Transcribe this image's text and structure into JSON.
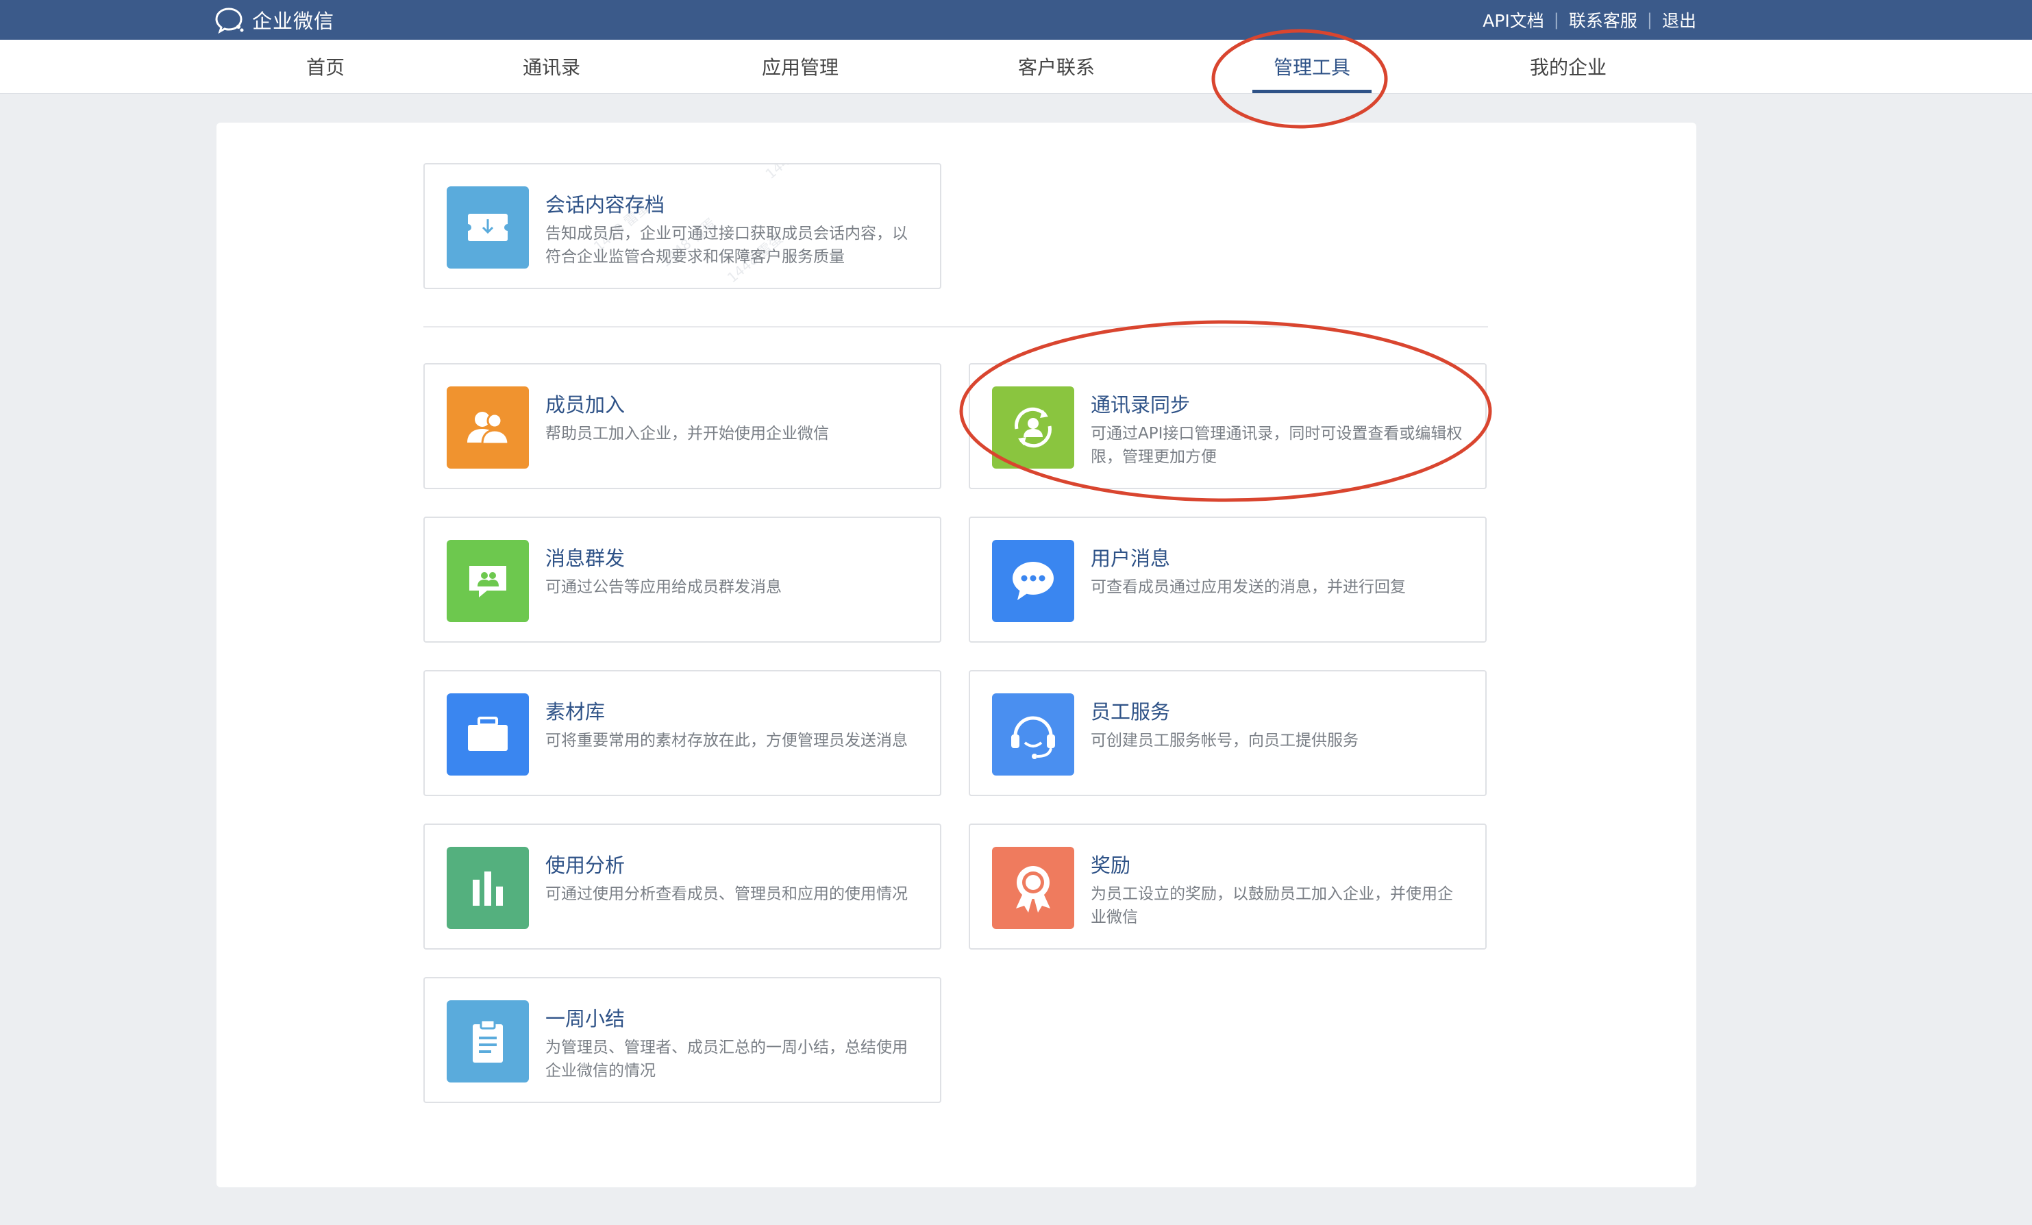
{
  "header": {
    "logo_text": "企业微信",
    "links": [
      "API文档",
      "联系客服",
      "退出"
    ],
    "bar_color": "#3b5a8a"
  },
  "nav": {
    "tabs": [
      "首页",
      "通讯录",
      "应用管理",
      "客户联系",
      "管理工具",
      "我的企业"
    ],
    "active_tab": "管理工具",
    "accent_color": "#2e5287"
  },
  "tools": {
    "archive": {
      "title": "会话内容存档",
      "desc": "告知成员后，企业可通过接口获取成员会话内容，以符合企业监管合规要求和保障客户服务质量",
      "icon": "download-box-icon",
      "color": "#5aabdc"
    },
    "member_join": {
      "title": "成员加入",
      "desc": "帮助员工加入企业，并开始使用企业微信",
      "icon": "two-people-icon",
      "color": "#f0932f"
    },
    "contacts_sync": {
      "title": "通讯录同步",
      "desc": "可通过API接口管理通讯录，同时可设置查看或编辑权限，管理更加方便",
      "icon": "person-sync-icon",
      "color": "#8ac53f"
    },
    "broadcast": {
      "title": "消息群发",
      "desc": "可通过公告等应用给成员群发消息",
      "icon": "group-message-icon",
      "color": "#6dc84e"
    },
    "user_messages": {
      "title": "用户消息",
      "desc": "可查看成员通过应用发送的消息，并进行回复",
      "icon": "chat-bubble-icon",
      "color": "#3a86f0"
    },
    "materials": {
      "title": "素材库",
      "desc": "可将重要常用的素材存放在此，方便管理员发送消息",
      "icon": "briefcase-icon",
      "color": "#3a86f0"
    },
    "staff_service": {
      "title": "员工服务",
      "desc": "可创建员工服务帐号，向员工提供服务",
      "icon": "headset-icon",
      "color": "#4a8ff0"
    },
    "analytics": {
      "title": "使用分析",
      "desc": "可通过使用分析查看成员、管理员和应用的使用情况",
      "icon": "bar-chart-icon",
      "color": "#54b07e"
    },
    "rewards": {
      "title": "奖励",
      "desc": "为员工设立的奖励，以鼓励员工加入企业，并使用企业微信",
      "icon": "medal-icon",
      "color": "#ef7b5e"
    },
    "weekly_summary": {
      "title": "一周小结",
      "desc": "为管理员、管理者、成员汇总的一周小结，总结使用企业微信的情况",
      "icon": "clipboard-icon",
      "color": "#5aabdc"
    }
  },
  "annotation_color": "#d9452f"
}
